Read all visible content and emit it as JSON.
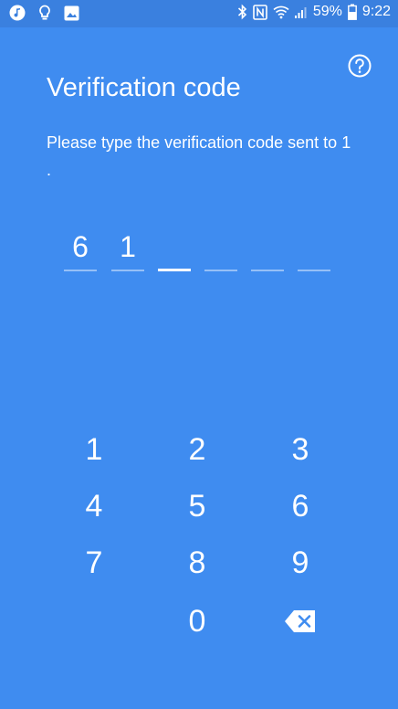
{
  "status_bar": {
    "left_icons": [
      "music-note-icon",
      "lightbulb-icon",
      "image-icon"
    ],
    "battery_percent": "59%",
    "time": "9:22"
  },
  "header": {
    "title": "Verification code",
    "subtitle": "Please type the verification code sent to 1                              ."
  },
  "code": {
    "digits": [
      "6",
      "1",
      "",
      "",
      "",
      ""
    ],
    "active_index": 2
  },
  "keypad": {
    "keys": [
      "1",
      "2",
      "3",
      "4",
      "5",
      "6",
      "7",
      "8",
      "9",
      "0"
    ]
  },
  "colors": {
    "background": "#3f8cf0",
    "status_bar": "#3a80df",
    "text": "#ffffff"
  }
}
